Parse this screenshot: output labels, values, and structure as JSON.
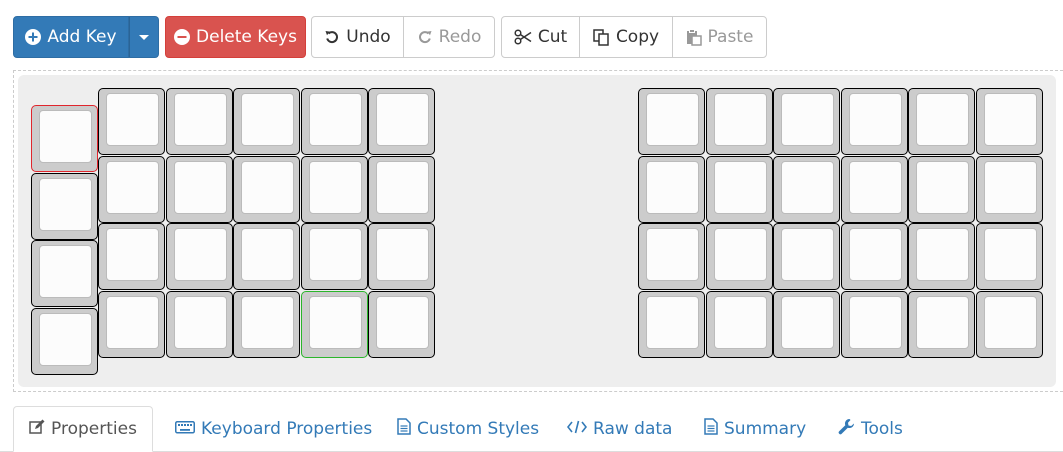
{
  "toolbar": {
    "add_key_label": "Add Key",
    "delete_keys_label": "Delete Keys",
    "undo_label": "Undo",
    "redo_label": "Redo",
    "cut_label": "Cut",
    "copy_label": "Copy",
    "paste_label": "Paste",
    "icons": {
      "add": "plus-circle-icon",
      "dropdown": "caret-down-icon",
      "delete": "minus-circle-icon",
      "undo": "undo-icon",
      "redo": "redo-icon",
      "cut": "scissors-icon",
      "copy": "copy-icon",
      "paste": "paste-icon"
    }
  },
  "keyboard": {
    "left_half": {
      "thumb_column_keys": 4,
      "grid_rows": 4,
      "grid_columns": 5
    },
    "right_half": {
      "grid_rows": 4,
      "grid_columns": 6
    },
    "selected_key_color": "#e0262d",
    "highlighted_key_color": "#2bb52b",
    "key_color": "#cccccc",
    "cap_color": "#fcfcfc"
  },
  "tabs": [
    {
      "label": "Properties",
      "icon": "edit-icon",
      "active": true
    },
    {
      "label": "Keyboard Properties",
      "icon": "keyboard-icon",
      "active": false
    },
    {
      "label": "Custom Styles",
      "icon": "document-icon",
      "active": false
    },
    {
      "label": "Raw data",
      "icon": "code-icon",
      "active": false
    },
    {
      "label": "Summary",
      "icon": "document-icon",
      "active": false
    },
    {
      "label": "Tools",
      "icon": "wrench-icon",
      "active": false
    }
  ],
  "colors": {
    "primary": "#337ab7",
    "danger": "#d9534f",
    "tab_link": "#337ab7"
  }
}
